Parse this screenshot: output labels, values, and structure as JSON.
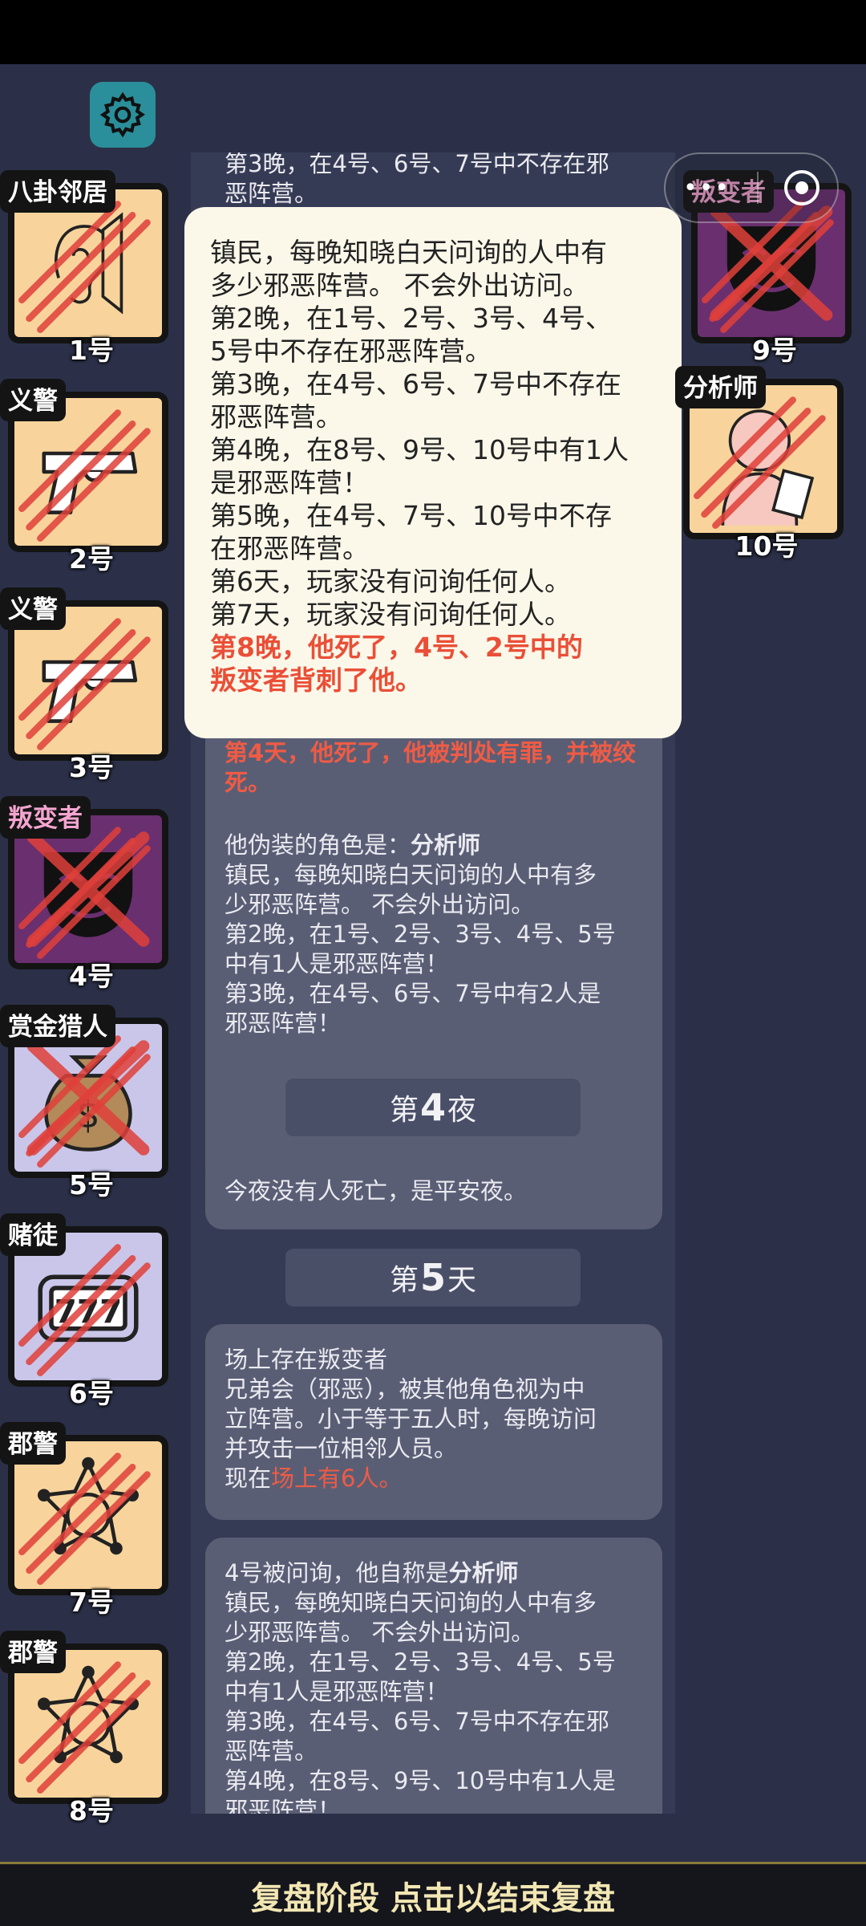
{
  "footer": {
    "label": "复盘阶段 点击以结束复盘"
  },
  "log": {
    "top_partial_1": "第3晚，在4号、6号、7号中不存在邪",
    "top_partial_2": "恶阵营。",
    "card1": {
      "death": "第4天，他死了，他被判处有罪，并被绞死。",
      "disguise_prefix": "他伪装的角色是：",
      "disguise_role": "分析师",
      "lines": [
        "镇民，每晚知晓白天问询的人中有多",
        "少邪恶阵营。 不会外出访问。",
        "第2晚，在1号、2号、3号、4号、5号",
        "中有1人是邪恶阵营！",
        "第3晚，在4号、6号、7号中有2人是",
        "邪恶阵营！"
      ]
    },
    "phase_night4": {
      "prefix": "第",
      "number": "4",
      "suffix": "夜"
    },
    "card2": {
      "text": "今夜没有人死亡，是平安夜。"
    },
    "phase_day5": {
      "prefix": "第",
      "number": "5",
      "suffix": "天"
    },
    "card3": {
      "lines": [
        "场上存在叛变者",
        "兄弟会（邪恶），被其他角色视为中",
        "立阵营。小于等于五人时，每晚访问",
        "并攻击一位相邻人员。"
      ],
      "now_prefix": "现在",
      "now_value": "场上有6人。"
    },
    "card4": {
      "claim_prefix": "4号被问询，他自称是",
      "claim_role": "分析师",
      "lines": [
        "镇民，每晚知晓白天问询的人中有多",
        "少邪恶阵营。 不会外出访问。",
        "第2晚，在1号、2号、3号、4号、5号",
        "中有1人是邪恶阵营！",
        "第3晚，在4号、6号、7号中不存在邪",
        "恶阵营。",
        "第4晚，在8号、9号、10号中有1人是",
        "邪恶阵营！"
      ]
    }
  },
  "tooltip": {
    "lines": [
      "镇民，每晚知晓白天问询的人中有",
      "多少邪恶阵营。 不会外出访问。",
      "第2晚，在1号、2号、3号、4号、",
      "5号中不存在邪恶阵营。",
      "第3晚，在4号、6号、7号中不存在",
      "邪恶阵营。",
      "第4晚，在8号、9号、10号中有1人",
      "是邪恶阵营！",
      "第5晚，在4号、7号、10号中不存",
      "在邪恶阵营。",
      "第6天，玩家没有问询任何人。",
      "第7天，玩家没有问询任何人。"
    ],
    "death_lines": [
      "第8晚，他死了，4号、2号中的",
      "叛变者背刺了他。"
    ]
  },
  "players": [
    {
      "role": "八卦邻居",
      "number": "1号",
      "icon": "ear-icon",
      "bg": "#f8d49c",
      "crossed": false
    },
    {
      "role": "义警",
      "number": "2号",
      "icon": "pistol-icon",
      "bg": "#f8d49c",
      "crossed": false
    },
    {
      "role": "义警",
      "number": "3号",
      "icon": "pistol-icon",
      "bg": "#f8d49c",
      "crossed": false
    },
    {
      "role": "叛变者",
      "number": "4号",
      "icon": "mask-icon",
      "bg": "#6a2f6f",
      "crossed": true
    },
    {
      "role": "赏金猎人",
      "number": "5号",
      "icon": "money-bag-icon",
      "bg": "#c9c6ea",
      "crossed": true
    },
    {
      "role": "赌徒",
      "number": "6号",
      "icon": "slot-machine-icon",
      "bg": "#c9c6ea",
      "crossed": false
    },
    {
      "role": "郡警",
      "number": "7号",
      "icon": "sheriff-badge-icon",
      "bg": "#f8d49c",
      "crossed": false
    },
    {
      "role": "郡警",
      "number": "8号",
      "icon": "sheriff-badge-icon",
      "bg": "#f8d49c",
      "crossed": false
    },
    {
      "role": "叛变者",
      "number": "9号",
      "icon": "mask-icon",
      "bg": "#6a2f6f",
      "crossed": true
    },
    {
      "role": "分析师",
      "number": "10号",
      "icon": "thinking-person-icon",
      "bg": "#f8d49c",
      "crossed": false
    }
  ],
  "colors": {
    "background": "#2b3048",
    "accent_red": "#ef5b45",
    "tooltip_bg": "#fbf8ea"
  }
}
